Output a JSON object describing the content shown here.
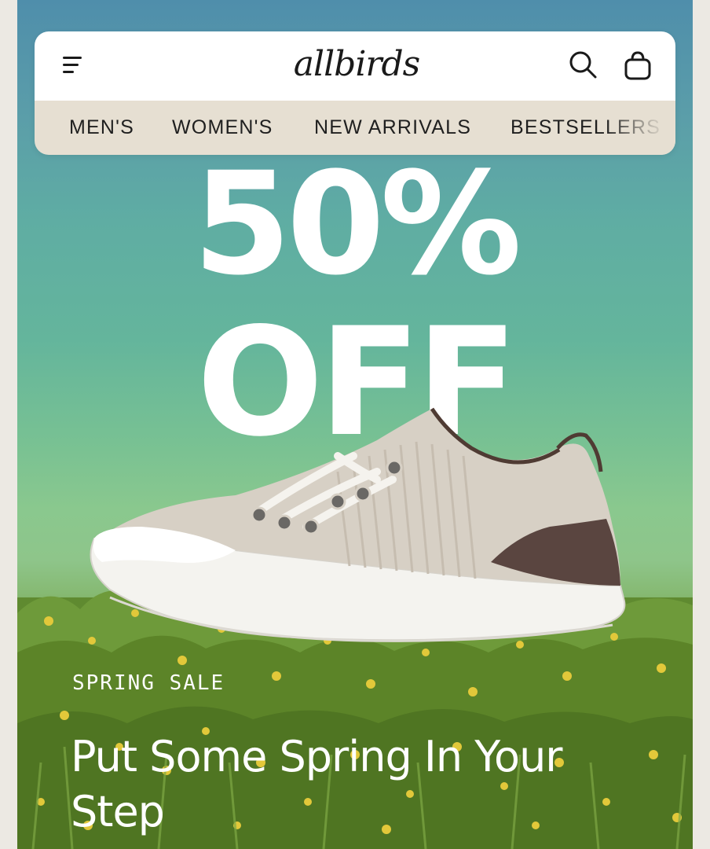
{
  "header": {
    "brand": "allbirds",
    "nav": [
      {
        "label": "MEN'S"
      },
      {
        "label": "WOMEN'S"
      },
      {
        "label": "NEW ARRIVALS"
      },
      {
        "label": "BESTSELLERS"
      }
    ],
    "icons": {
      "menu": "hamburger-menu-icon",
      "search": "search-icon",
      "cart": "shopping-bag-icon"
    }
  },
  "hero": {
    "promo_line1": "50%",
    "promo_line2": "OFF",
    "eyebrow": "SPRING SALE",
    "headline": "Put Some Spring In Your Step"
  },
  "colors": {
    "sky_top": "#4f8eab",
    "sky_mid": "#64b59c",
    "grass": "#6b9437",
    "nav_bg": "#e6dfd2",
    "promo_text": "#ffffff"
  }
}
